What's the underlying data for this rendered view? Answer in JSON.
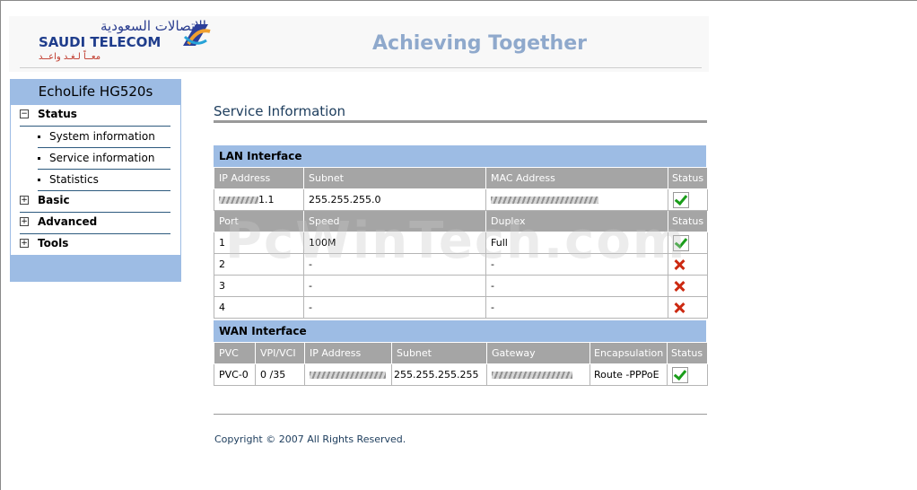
{
  "header": {
    "logo_ar": "الاتصالات السعودية",
    "logo_en": "SAUDI TELECOM",
    "logo_ar_sub": "معــاً لـغـد واعــد",
    "slogan": "Achieving Together"
  },
  "sidebar": {
    "model": "EchoLife HG520s",
    "status": "Status",
    "status_items": [
      "System information",
      "Service information",
      "Statistics"
    ],
    "basic": "Basic",
    "advanced": "Advanced",
    "tools": "Tools"
  },
  "page": {
    "title": "Service Information",
    "lan_title": "LAN Interface",
    "lan_headers": [
      "IP Address",
      "Subnet",
      "MAC Address",
      "Status"
    ],
    "lan_row": {
      "ip": "1.1",
      "subnet": "255.255.255.0"
    },
    "port_headers": [
      "Port",
      "Speed",
      "Duplex",
      "Status"
    ],
    "ports": [
      {
        "port": "1",
        "speed": "100M",
        "duplex": "Full",
        "status": "up"
      },
      {
        "port": "2",
        "speed": "-",
        "duplex": "-",
        "status": "down"
      },
      {
        "port": "3",
        "speed": "-",
        "duplex": "-",
        "status": "down"
      },
      {
        "port": "4",
        "speed": "-",
        "duplex": "-",
        "status": "down"
      }
    ],
    "wan_title": "WAN Interface",
    "wan_headers": [
      "PVC",
      "VPI/VCI",
      "IP Address",
      "Subnet",
      "Gateway",
      "Encapsulation",
      "Status"
    ],
    "wan_row": {
      "pvc": "PVC-0",
      "vpi_vci": "0 /35",
      "subnet": "255.255.255.255",
      "encap": "Route -PPPoE"
    },
    "copyright": "Copyright © 2007 All Rights Reserved."
  },
  "watermark": "PcWinTech.com",
  "colors": {
    "accent": "#9dbce4",
    "header_gray": "#a5a5a5",
    "ok": "#1a9d1a",
    "bad": "#cc2a12"
  }
}
